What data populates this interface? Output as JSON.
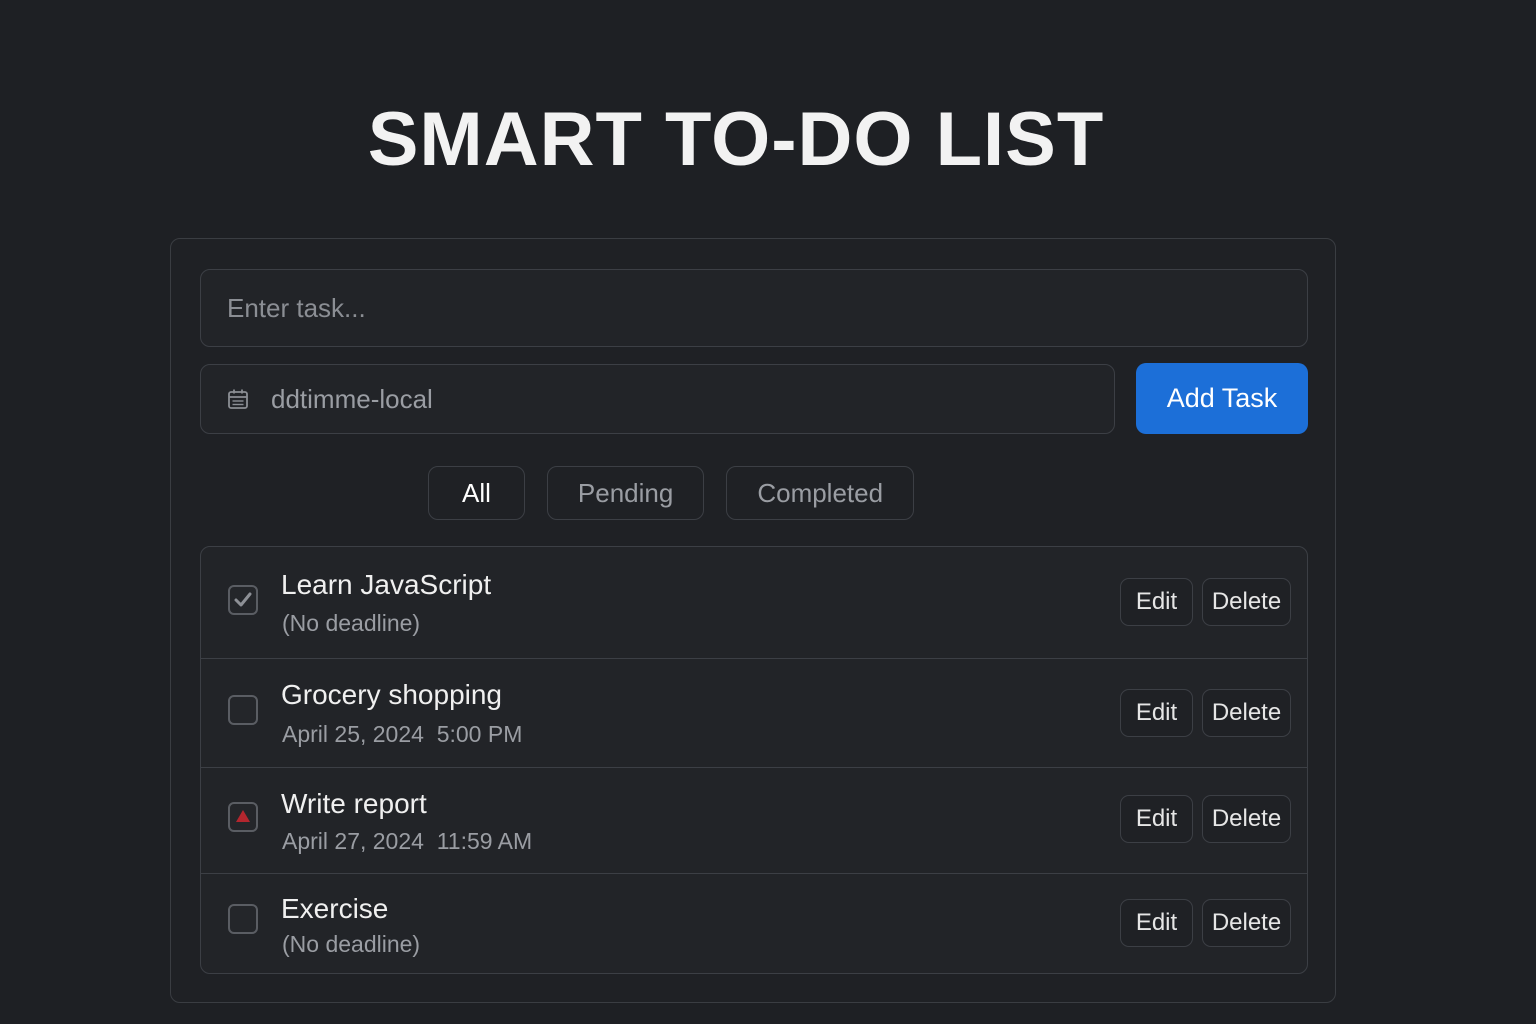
{
  "app": {
    "title": "SMART TO-DO LIST"
  },
  "form": {
    "task_placeholder": "Enter task...",
    "task_value": "",
    "datetime_value": "ddtimme-local",
    "datetime_icon": "calendar-icon",
    "add_label": "Add Task"
  },
  "filters": [
    {
      "label": "All",
      "active": true
    },
    {
      "label": "Pending",
      "active": false
    },
    {
      "label": "Completed",
      "active": false
    }
  ],
  "tasks": [
    {
      "name": "Learn JavaScript",
      "deadline": "(No deadline)",
      "status": "checked",
      "edit_label": "Edit",
      "delete_label": "Delete"
    },
    {
      "name": "Grocery shopping",
      "deadline": "April 25, 2024  5:00 PM",
      "status": "unchecked",
      "edit_label": "Edit",
      "delete_label": "Delete"
    },
    {
      "name": "Write report",
      "deadline": "April 27, 2024  11:59 AM",
      "status": "overdue",
      "edit_label": "Edit",
      "delete_label": "Delete"
    },
    {
      "name": "Exercise",
      "deadline": "(No deadline)",
      "status": "unchecked",
      "edit_label": "Edit",
      "delete_label": "Delete"
    }
  ],
  "colors": {
    "background": "#1e2024",
    "accent": "#1c6fd8",
    "overdue": "#b3262e"
  }
}
